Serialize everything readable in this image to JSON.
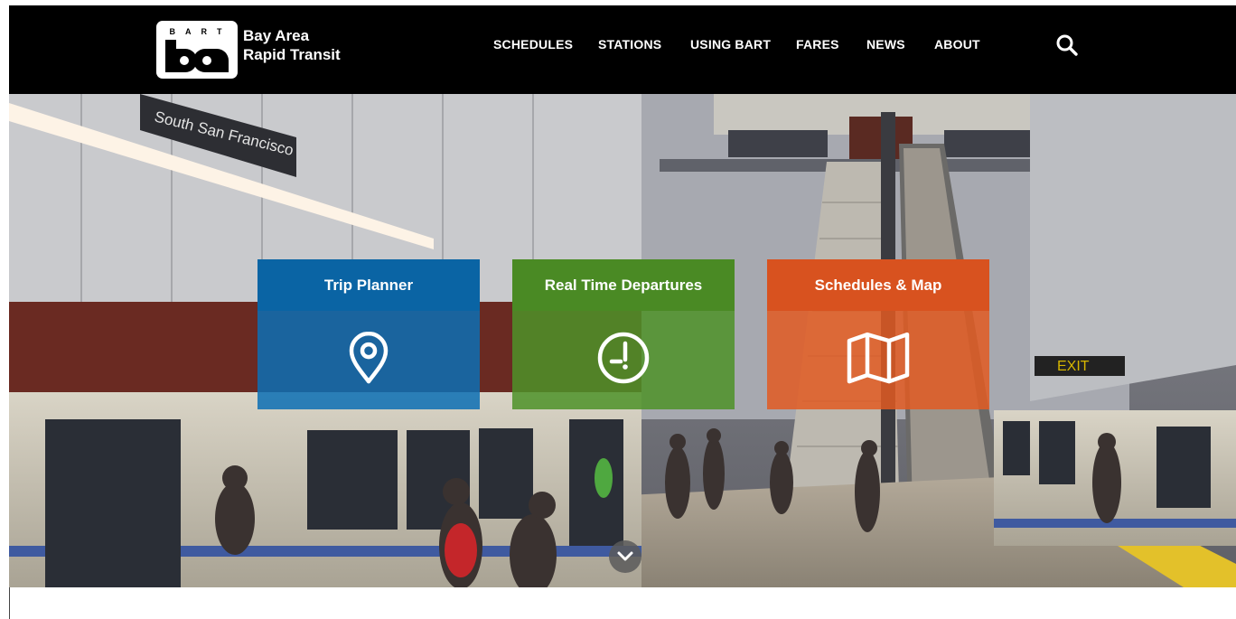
{
  "header": {
    "logo_small_text": "BART",
    "logo_letters": "ba",
    "brand_line1": "Bay Area",
    "brand_line2": "Rapid Transit"
  },
  "nav": [
    {
      "label": "SCHEDULES"
    },
    {
      "label": "STATIONS"
    },
    {
      "label": "USING BART"
    },
    {
      "label": "FARES"
    },
    {
      "label": "NEWS"
    },
    {
      "label": "ABOUT"
    }
  ],
  "search_icon": "search-icon",
  "hero": {
    "station_sign": "South San Francisco",
    "exit_sign": "EXIT"
  },
  "tiles": [
    {
      "title": "Trip Planner",
      "icon": "map-pin-icon",
      "color": "#0a64a4"
    },
    {
      "title": "Real Time Departures",
      "icon": "clock-icon",
      "color": "#4a8a24"
    },
    {
      "title": "Schedules & Map",
      "icon": "folded-map-icon",
      "color": "#d8521f"
    }
  ],
  "scroll_icon": "chevron-down-icon"
}
